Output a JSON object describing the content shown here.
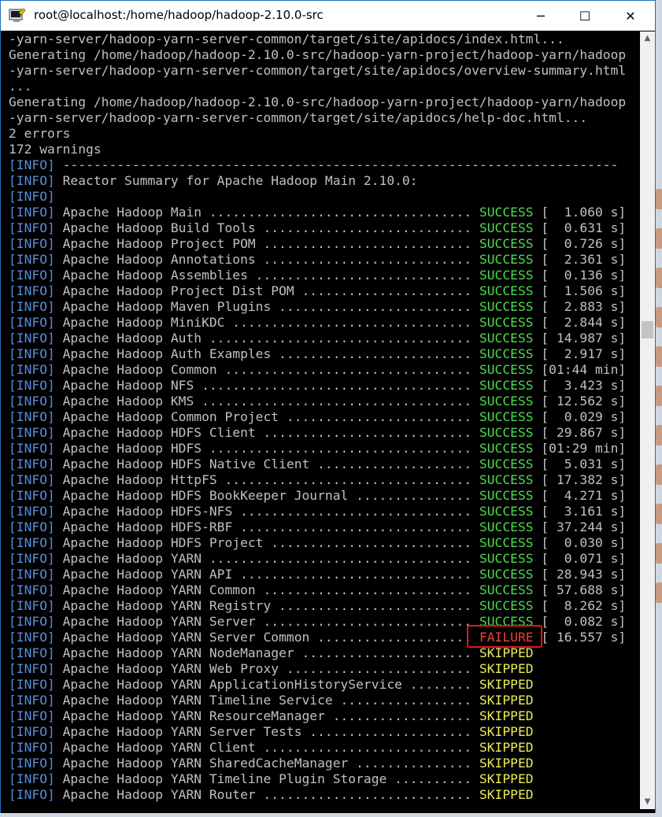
{
  "window": {
    "title": "root@localhost:/home/hadoop/hadoop-2.10.0-src",
    "minimize_glyph": "─",
    "maximize_glyph": "☐",
    "close_glyph": "✕",
    "icon": "putty-terminal-icon"
  },
  "scrollbar": {
    "up_glyph": "▲",
    "down_glyph": "▼"
  },
  "colors": {
    "info_tag": "#5b8ad6",
    "success": "#4fdc4f",
    "failure": "#e8443a",
    "skipped": "#ecec57",
    "highlight_box": "#e51616"
  },
  "preamble": [
    "-yarn-server/hadoop-yarn-server-common/target/site/apidocs/index.html...",
    "Generating /home/hadoop/hadoop-2.10.0-src/hadoop-yarn-project/hadoop-yarn/hadoop",
    "-yarn-server/hadoop-yarn-server-common/target/site/apidocs/overview-summary.html",
    "...",
    "Generating /home/hadoop/hadoop-2.10.0-src/hadoop-yarn-project/hadoop-yarn/hadoop",
    "-yarn-server/hadoop-yarn-server-common/target/site/apidocs/help-doc.html...",
    "2 errors",
    "172 warnings"
  ],
  "info_tag": "[INFO]",
  "separator": " ------------------------------------------------------------------------",
  "summary_title": " Reactor Summary for Apache Hadoop Main 2.10.0:",
  "modules": [
    {
      "text": " Apache Hadoop Main .................................. ",
      "status": "SUCCESS",
      "time": " [  1.060 s]"
    },
    {
      "text": " Apache Hadoop Build Tools ........................... ",
      "status": "SUCCESS",
      "time": " [  0.631 s]"
    },
    {
      "text": " Apache Hadoop Project POM ........................... ",
      "status": "SUCCESS",
      "time": " [  0.726 s]"
    },
    {
      "text": " Apache Hadoop Annotations ........................... ",
      "status": "SUCCESS",
      "time": " [  2.361 s]"
    },
    {
      "text": " Apache Hadoop Assemblies ............................ ",
      "status": "SUCCESS",
      "time": " [  0.136 s]"
    },
    {
      "text": " Apache Hadoop Project Dist POM ...................... ",
      "status": "SUCCESS",
      "time": " [  1.506 s]"
    },
    {
      "text": " Apache Hadoop Maven Plugins ......................... ",
      "status": "SUCCESS",
      "time": " [  2.883 s]"
    },
    {
      "text": " Apache Hadoop MiniKDC ............................... ",
      "status": "SUCCESS",
      "time": " [  2.844 s]"
    },
    {
      "text": " Apache Hadoop Auth .................................. ",
      "status": "SUCCESS",
      "time": " [ 14.987 s]"
    },
    {
      "text": " Apache Hadoop Auth Examples ......................... ",
      "status": "SUCCESS",
      "time": " [  2.917 s]"
    },
    {
      "text": " Apache Hadoop Common ................................ ",
      "status": "SUCCESS",
      "time": " [01:44 min]"
    },
    {
      "text": " Apache Hadoop NFS ................................... ",
      "status": "SUCCESS",
      "time": " [  3.423 s]"
    },
    {
      "text": " Apache Hadoop KMS ................................... ",
      "status": "SUCCESS",
      "time": " [ 12.562 s]"
    },
    {
      "text": " Apache Hadoop Common Project ........................ ",
      "status": "SUCCESS",
      "time": " [  0.029 s]"
    },
    {
      "text": " Apache Hadoop HDFS Client ........................... ",
      "status": "SUCCESS",
      "time": " [ 29.867 s]"
    },
    {
      "text": " Apache Hadoop HDFS .................................. ",
      "status": "SUCCESS",
      "time": " [01:29 min]"
    },
    {
      "text": " Apache Hadoop HDFS Native Client .................... ",
      "status": "SUCCESS",
      "time": " [  5.031 s]"
    },
    {
      "text": " Apache Hadoop HttpFS ................................ ",
      "status": "SUCCESS",
      "time": " [ 17.382 s]"
    },
    {
      "text": " Apache Hadoop HDFS BookKeeper Journal ............... ",
      "status": "SUCCESS",
      "time": " [  4.271 s]"
    },
    {
      "text": " Apache Hadoop HDFS-NFS .............................. ",
      "status": "SUCCESS",
      "time": " [  3.161 s]"
    },
    {
      "text": " Apache Hadoop HDFS-RBF .............................. ",
      "status": "SUCCESS",
      "time": " [ 37.244 s]"
    },
    {
      "text": " Apache Hadoop HDFS Project .......................... ",
      "status": "SUCCESS",
      "time": " [  0.030 s]"
    },
    {
      "text": " Apache Hadoop YARN .................................. ",
      "status": "SUCCESS",
      "time": " [  0.071 s]"
    },
    {
      "text": " Apache Hadoop YARN API .............................. ",
      "status": "SUCCESS",
      "time": " [ 28.943 s]"
    },
    {
      "text": " Apache Hadoop YARN Common ........................... ",
      "status": "SUCCESS",
      "time": " [ 57.688 s]"
    },
    {
      "text": " Apache Hadoop YARN Registry ......................... ",
      "status": "SUCCESS",
      "time": " [  8.262 s]"
    },
    {
      "text": " Apache Hadoop YARN Server ........................... ",
      "status": "SUCCESS",
      "time": " [  0.082 s]"
    },
    {
      "text": " Apache Hadoop YARN Server Common .................... ",
      "status": "FAILURE",
      "time": " [ 16.557 s]"
    },
    {
      "text": " Apache Hadoop YARN NodeManager ...................... ",
      "status": "SKIPPED",
      "time": ""
    },
    {
      "text": " Apache Hadoop YARN Web Proxy ........................ ",
      "status": "SKIPPED",
      "time": ""
    },
    {
      "text": " Apache Hadoop YARN ApplicationHistoryService ........ ",
      "status": "SKIPPED",
      "time": ""
    },
    {
      "text": " Apache Hadoop YARN Timeline Service ................. ",
      "status": "SKIPPED",
      "time": ""
    },
    {
      "text": " Apache Hadoop YARN ResourceManager .................. ",
      "status": "SKIPPED",
      "time": ""
    },
    {
      "text": " Apache Hadoop YARN Server Tests ..................... ",
      "status": "SKIPPED",
      "time": ""
    },
    {
      "text": " Apache Hadoop YARN Client ........................... ",
      "status": "SKIPPED",
      "time": ""
    },
    {
      "text": " Apache Hadoop YARN SharedCacheManager ............... ",
      "status": "SKIPPED",
      "time": ""
    },
    {
      "text": " Apache Hadoop YARN Timeline Plugin Storage .......... ",
      "status": "SKIPPED",
      "time": ""
    },
    {
      "text": " Apache Hadoop YARN Router ........................... ",
      "status": "SKIPPED",
      "time": ""
    }
  ]
}
